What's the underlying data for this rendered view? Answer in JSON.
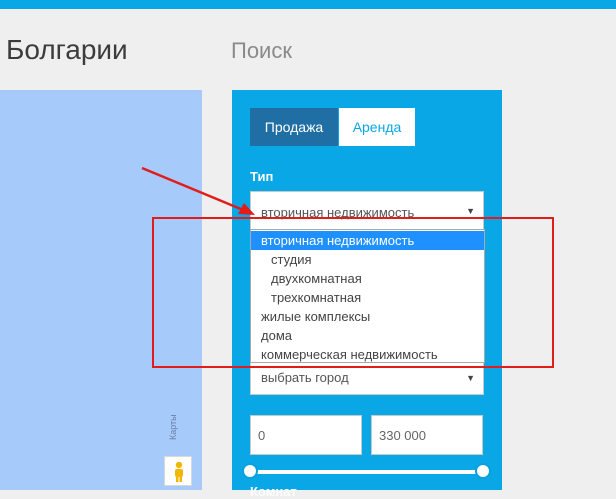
{
  "header": {
    "title_left": "Болгарии",
    "search_title": "Поиск"
  },
  "map": {
    "side_text": "Карты"
  },
  "search": {
    "tabs": [
      {
        "label": "Продажа",
        "active": true
      },
      {
        "label": "Аренда",
        "active": false
      }
    ],
    "type_label": "Тип",
    "type_value": "вторичная недвижимость",
    "type_options": [
      {
        "label": "вторичная недвижимость",
        "selected": true
      },
      {
        "label": "студия",
        "selected": false
      },
      {
        "label": "двухкомнатная",
        "selected": false
      },
      {
        "label": "трехкомнатная",
        "selected": false
      },
      {
        "label": "жилые комплексы",
        "selected": false
      },
      {
        "label": "дома",
        "selected": false
      },
      {
        "label": "коммерческая недвижимость",
        "selected": false
      }
    ],
    "city_value": "выбрать город",
    "price_min": "0",
    "price_max": "330 000",
    "price_slider": {
      "min_fraction": 0.0,
      "max_fraction": 1.0
    },
    "rooms_label": "Комнат"
  },
  "colors": {
    "accent": "#09a7e6",
    "active_tab": "#1f6fa4",
    "selected_option": "#1e90ff",
    "annotation": "#e21b1b",
    "map": "#a6cbfa"
  },
  "icons": {
    "caret": "triangle-down",
    "pegman": "street-view-person"
  }
}
